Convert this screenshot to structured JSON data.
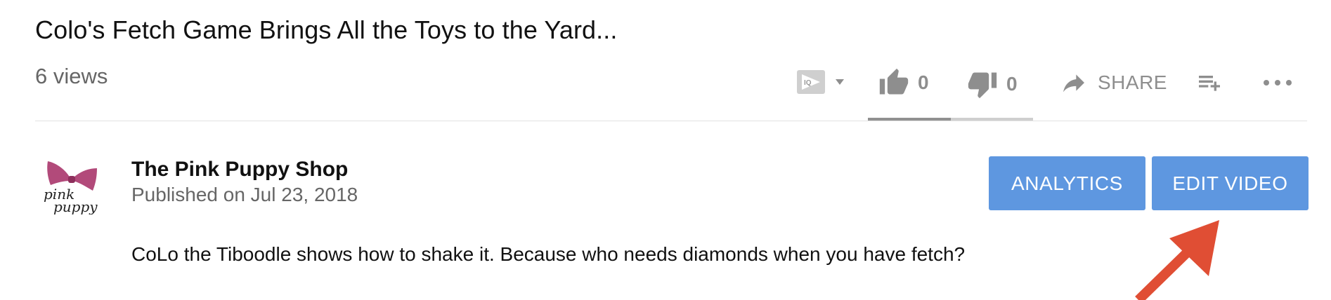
{
  "video": {
    "title": "Colo's Fetch Game Brings All the Toys to the Yard...",
    "views": "6 views"
  },
  "actions": {
    "like_count": "0",
    "dislike_count": "0",
    "share_label": "SHARE",
    "like_ratio": 0.5
  },
  "channel": {
    "name": "The Pink Puppy Shop",
    "published": "Published on Jul 23, 2018",
    "logo_text_line1": "pink",
    "logo_text_line2": "puppy",
    "logo_color": "#b24a7a"
  },
  "buttons": {
    "analytics": "ANALYTICS",
    "edit_video": "EDIT VIDEO"
  },
  "description": "CoLo the Tiboodle shows how to shake it. Because who needs diamonds when you have fetch?",
  "icons": {
    "extension": "tubebuddy-icon",
    "like": "thumbs-up-icon",
    "dislike": "thumbs-down-icon",
    "share": "share-arrow-icon",
    "playlist": "add-to-playlist-icon",
    "more": "more-icon"
  },
  "colors": {
    "button_bg": "#5e97e0",
    "annotation_arrow": "#e04e34"
  }
}
